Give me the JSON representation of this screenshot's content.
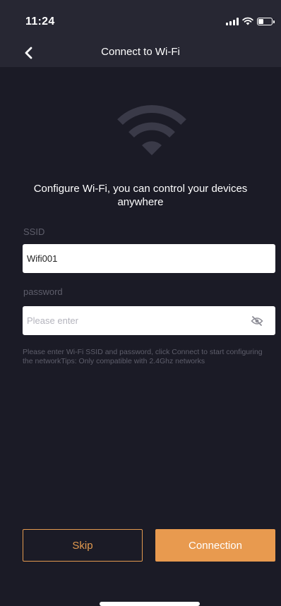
{
  "status_bar": {
    "time": "11:24",
    "icons": [
      "signal-icon",
      "wifi-icon",
      "battery-icon"
    ]
  },
  "nav": {
    "back_icon": "chevron-left-icon",
    "title": "Connect to Wi-Fi"
  },
  "hero": {
    "icon": "wifi-icon"
  },
  "intro_text": "Configure Wi-Fi, you can control your devices anywhere",
  "form": {
    "ssid_label": "SSID",
    "ssid_value": "Wifi001",
    "password_label": "password",
    "password_value": "",
    "password_placeholder": "Please enter",
    "visibility_icon": "eye-off-icon"
  },
  "hint_text": "Please enter Wi-Fi SSID and password, click Connect to start configuring the networkTips: Only compatible with 2.4Ghz networks",
  "buttons": {
    "skip_label": "Skip",
    "connect_label": "Connection"
  },
  "colors": {
    "background": "#1b1b26",
    "header": "#272733",
    "accent": "#e89a4f",
    "muted_text": "#5e5e6b"
  }
}
